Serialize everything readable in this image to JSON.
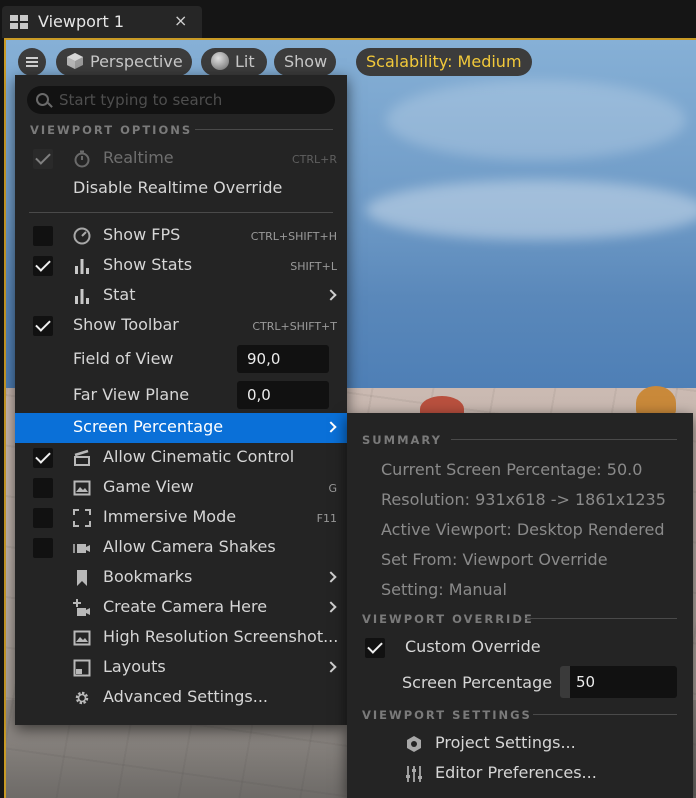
{
  "tab": {
    "title": "Viewport 1",
    "close": "×"
  },
  "toolbar": {
    "perspective": "Perspective",
    "lit": "Lit",
    "show": "Show",
    "scalability": "Scalability: Medium",
    "scalability_color": "#f2c93a"
  },
  "menu": {
    "search_placeholder": "Start typing to search",
    "section_viewport_options": "VIEWPORT OPTIONS",
    "items": [
      {
        "label": "Realtime",
        "shortcut": "CTRL+R",
        "checked": true,
        "disabled": true,
        "icon": "stopwatch-icon"
      },
      {
        "label": "Disable Realtime Override"
      },
      {
        "label": "Show FPS",
        "shortcut": "CTRL+SHIFT+H",
        "checked": false,
        "icon": "speedometer-icon"
      },
      {
        "label": "Show Stats",
        "shortcut": "SHIFT+L",
        "checked": true,
        "icon": "bar-chart-icon"
      },
      {
        "label": "Stat",
        "icon": "bar-chart-icon",
        "submenu": true
      },
      {
        "label": "Show Toolbar",
        "shortcut": "CTRL+SHIFT+T",
        "checked": true
      },
      {
        "label": "Field of View",
        "value": "90,0"
      },
      {
        "label": "Far View Plane",
        "value": "0,0"
      },
      {
        "label": "Screen Percentage",
        "submenu": true,
        "selected": true
      },
      {
        "label": "Allow Cinematic Control",
        "checked": true,
        "icon": "clapperboard-icon"
      },
      {
        "label": "Game View",
        "shortcut": "G",
        "checked": false,
        "icon": "landscape-icon"
      },
      {
        "label": "Immersive Mode",
        "shortcut": "F11",
        "checked": false,
        "icon": "fullscreen-icon"
      },
      {
        "label": "Allow Camera Shakes",
        "checked": false,
        "icon": "camera-shake-icon"
      },
      {
        "label": "Bookmarks",
        "submenu": true,
        "icon": "bookmark-icon"
      },
      {
        "label": "Create Camera Here",
        "submenu": true,
        "icon": "add-camera-icon"
      },
      {
        "label": "High Resolution Screenshot...",
        "icon": "screenshot-icon"
      },
      {
        "label": "Layouts",
        "submenu": true,
        "icon": "layout-icon"
      },
      {
        "label": "Advanced Settings...",
        "icon": "gear-icon"
      }
    ]
  },
  "submenu": {
    "section_summary": "SUMMARY",
    "summary": [
      "Current Screen Percentage: 50.0",
      "Resolution: 931x618 -> 1861x1235",
      "Active Viewport: Desktop Rendered",
      "Set From: Viewport Override",
      "Setting: Manual"
    ],
    "section_override": "VIEWPORT OVERRIDE",
    "custom_override": "Custom Override",
    "screen_percentage_label": "Screen Percentage",
    "screen_percentage_value": "50",
    "section_settings": "VIEWPORT SETTINGS",
    "project_settings": "Project Settings...",
    "editor_preferences": "Editor Preferences..."
  },
  "colors": {
    "selection": "#0a70d8",
    "viewport_border": "#c89a26",
    "menu_bg": "#242424"
  }
}
